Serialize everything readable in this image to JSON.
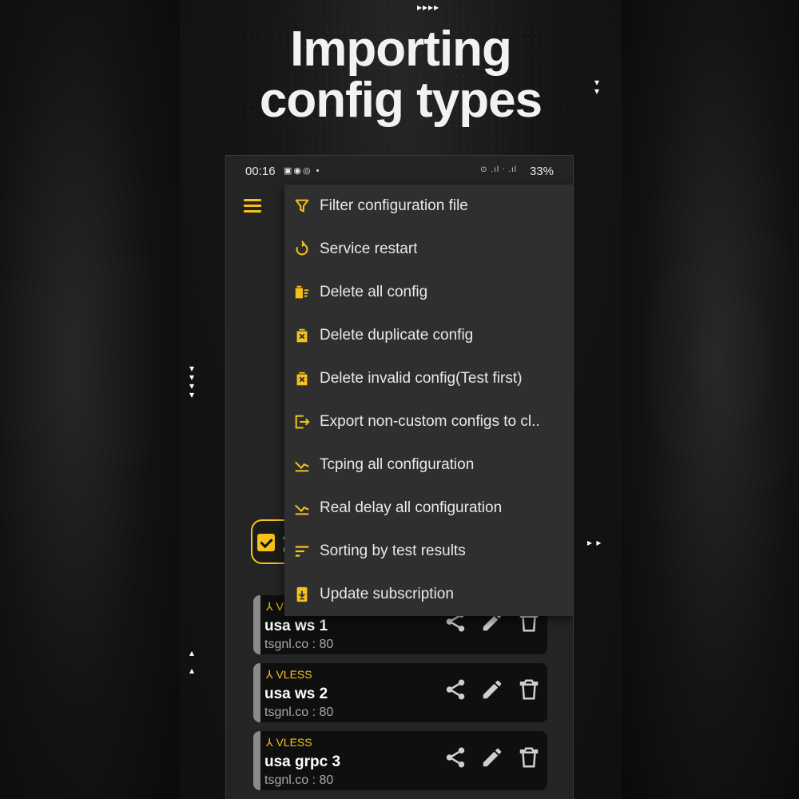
{
  "headline": {
    "line1": "Importing",
    "line2": "config types"
  },
  "status_bar": {
    "time": "00:16",
    "battery": "33%"
  },
  "menu": {
    "items": [
      {
        "label": "Filter configuration file",
        "icon": "filter-icon"
      },
      {
        "label": "Service restart",
        "icon": "restart-icon"
      },
      {
        "label": "Delete all config",
        "icon": "delete-all-icon"
      },
      {
        "label": "Delete duplicate config",
        "icon": "delete-icon"
      },
      {
        "label": "Delete invalid config(Test first)",
        "icon": "delete-icon"
      },
      {
        "label": "Export non-custom configs to cl..",
        "icon": "export-icon"
      },
      {
        "label": "Tcping all configuration",
        "icon": "ping-icon"
      },
      {
        "label": "Real delay all configuration",
        "icon": "ping-icon"
      },
      {
        "label": "Sorting by test results",
        "icon": "sort-icon"
      },
      {
        "label": "Update subscription",
        "icon": "update-icon"
      }
    ]
  },
  "chip": {
    "line1": "A",
    "line2": "C"
  },
  "configs": [
    {
      "type": "V",
      "name": "usa ws 1",
      "address": "tsgnl.co : 80"
    },
    {
      "type": "VLESS",
      "name": "usa ws 2",
      "address": "tsgnl.co : 80"
    },
    {
      "type": "VLESS",
      "name": "usa grpc 3",
      "address": "tsgnl.co : 80"
    }
  ],
  "colors": {
    "accent": "#f6c21a",
    "menu_bg": "#2f2f2f",
    "card_bg": "#0f0f0f",
    "text": "#e9e9e9"
  }
}
